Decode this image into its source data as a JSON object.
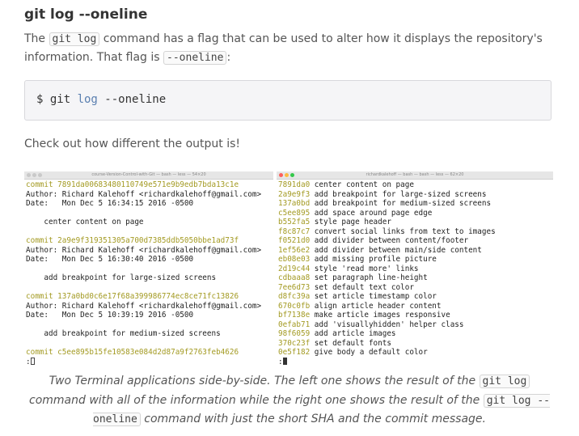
{
  "heading": "git log --oneline",
  "intro": {
    "part1": "The ",
    "code1": "git log",
    "part2": " command has a flag that can be used to alter how it displays the repository's information. That flag is ",
    "code2": "--oneline",
    "part3": ":"
  },
  "codeblock": {
    "prompt": "$ git ",
    "keyword": "log",
    "rest": " --oneline"
  },
  "check_text": "Check out how different the output is!",
  "left_terminal": {
    "title": "course-Version-Control-with-Git — bash — less — 54×20",
    "lines": [
      {
        "text": "commit 7891da00683480110749e571e9b9edb7bda13c1e",
        "style": "yellow"
      },
      {
        "text": "Author: Richard Kalehoff <richardkalehoff@gmail.com>",
        "style": ""
      },
      {
        "text": "Date:   Mon Dec 5 16:34:15 2016 -0500",
        "style": ""
      },
      {
        "text": "",
        "style": ""
      },
      {
        "text": "    center content on page",
        "style": ""
      },
      {
        "text": "",
        "style": ""
      },
      {
        "text": "commit 2a9e9f319351305a700d7385ddb5050bbe1ad73f",
        "style": "yellow"
      },
      {
        "text": "Author: Richard Kalehoff <richardkalehoff@gmail.com>",
        "style": ""
      },
      {
        "text": "Date:   Mon Dec 5 16:30:40 2016 -0500",
        "style": ""
      },
      {
        "text": "",
        "style": ""
      },
      {
        "text": "    add breakpoint for large-sized screens",
        "style": ""
      },
      {
        "text": "",
        "style": ""
      },
      {
        "text": "commit 137a0bd0c6e17f68a399986774ec8ce71fc13826",
        "style": "yellow"
      },
      {
        "text": "Author: Richard Kalehoff <richardkalehoff@gmail.com>",
        "style": ""
      },
      {
        "text": "Date:   Mon Dec 5 10:39:19 2016 -0500",
        "style": ""
      },
      {
        "text": "",
        "style": ""
      },
      {
        "text": "    add breakpoint for medium-sized screens",
        "style": ""
      },
      {
        "text": "",
        "style": ""
      },
      {
        "text": "commit c5ee895b15fe10583e084d2d87a9f2763feb4626",
        "style": "yellow"
      }
    ],
    "prompt": ":"
  },
  "right_terminal": {
    "title": "richardkalehoff — bash — bash — less — 62×20",
    "entries": [
      {
        "sha": "7891da0",
        "msg": "center content on page"
      },
      {
        "sha": "2a9e9f3",
        "msg": "add breakpoint for large-sized screens"
      },
      {
        "sha": "137a0bd",
        "msg": "add breakpoint for medium-sized screens"
      },
      {
        "sha": "c5ee895",
        "msg": "add space around page edge"
      },
      {
        "sha": "b552fa5",
        "msg": "style page header"
      },
      {
        "sha": "f8c87c7",
        "msg": "convert social links from text to images"
      },
      {
        "sha": "f0521d0",
        "msg": "add divider between content/footer"
      },
      {
        "sha": "1ef56e2",
        "msg": "add divider between main/side content"
      },
      {
        "sha": "eb08e03",
        "msg": "add missing profile picture"
      },
      {
        "sha": "2d19c44",
        "msg": "style 'read more' links"
      },
      {
        "sha": "cdbaaa8",
        "msg": "set paragraph line-height"
      },
      {
        "sha": "7ee6d73",
        "msg": "set default text color"
      },
      {
        "sha": "d8fc39a",
        "msg": "set article timestamp color"
      },
      {
        "sha": "670c0fb",
        "msg": "align article header content"
      },
      {
        "sha": "bf7138e",
        "msg": "make article images responsive"
      },
      {
        "sha": "0efab71",
        "msg": "add 'visuallyhidden' helper class"
      },
      {
        "sha": "98f6059",
        "msg": "add article images"
      },
      {
        "sha": "370c23f",
        "msg": "set default fonts"
      },
      {
        "sha": "0e5f182",
        "msg": "give body a default color"
      }
    ],
    "prompt": ":"
  },
  "caption": {
    "part1": "Two Terminal applications side-by-side. The left one shows the result of the ",
    "code1": "git log",
    "part2": " command with all of the information while the right one shows the result of the ",
    "code2": "git log --oneline",
    "part3": " command with just the short SHA and the commit message."
  },
  "colors": {
    "sha": "#a39a22",
    "close": "#fc605c",
    "minimize": "#fdbc40",
    "zoom": "#34c84a"
  }
}
